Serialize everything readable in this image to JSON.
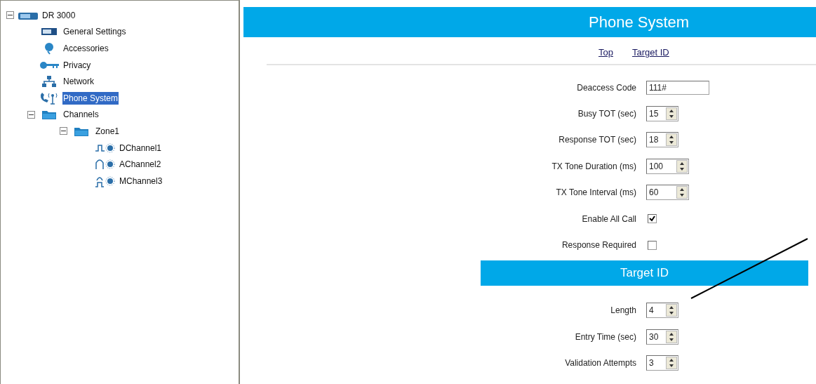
{
  "tree": [
    {
      "label": "DR 3000",
      "kind": "device",
      "expanded": true,
      "selected": false,
      "children": [
        {
          "label": "General Settings",
          "kind": "settings",
          "selected": false
        },
        {
          "label": "Accessories",
          "kind": "accessory",
          "selected": false
        },
        {
          "label": "Privacy",
          "kind": "key",
          "selected": false
        },
        {
          "label": "Network",
          "kind": "network",
          "selected": false
        },
        {
          "label": "Phone System",
          "kind": "phone",
          "selected": true
        },
        {
          "label": "Channels",
          "kind": "folder",
          "expanded": true,
          "selected": false,
          "children": [
            {
              "label": "Zone1",
              "kind": "folder",
              "expanded": true,
              "selected": false,
              "children": [
                {
                  "label": "DChannel1",
                  "kind": "digital",
                  "selected": false
                },
                {
                  "label": "AChannel2",
                  "kind": "analog",
                  "selected": false
                },
                {
                  "label": "MChannel3",
                  "kind": "mixed",
                  "selected": false
                }
              ]
            }
          ]
        }
      ]
    }
  ],
  "page": {
    "title": "Phone System",
    "links": [
      "Top",
      "Target ID"
    ],
    "fields": [
      {
        "label": "Deaccess Code",
        "kind": "text",
        "value": "111#"
      },
      {
        "label": "Busy TOT (sec)",
        "kind": "spin",
        "value": "15"
      },
      {
        "label": "Response TOT (sec)",
        "kind": "spin",
        "value": "18"
      },
      {
        "label": "TX Tone Duration (ms)",
        "kind": "spinwide",
        "value": "100"
      },
      {
        "label": "TX Tone Interval (ms)",
        "kind": "spinwide",
        "value": "60"
      },
      {
        "label": "Enable All Call",
        "kind": "checkbox",
        "checked": true
      },
      {
        "label": "Response Required",
        "kind": "checkbox",
        "checked": false
      }
    ],
    "section": {
      "title": "Target ID",
      "fields": [
        {
          "label": "Length",
          "kind": "spin",
          "value": "4"
        },
        {
          "label": "Entry Time (sec)",
          "kind": "spin",
          "value": "30"
        },
        {
          "label": "Validation Attempts",
          "kind": "spin",
          "value": "3"
        }
      ]
    }
  }
}
